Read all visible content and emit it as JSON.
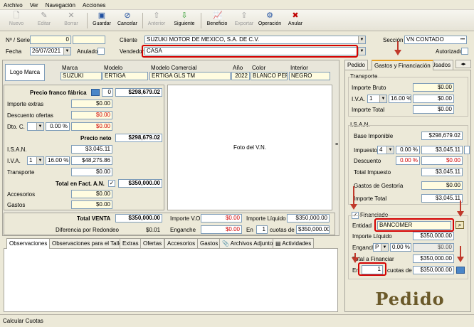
{
  "menu": [
    "Archivo",
    "Ver",
    "Navegación",
    "Acciones"
  ],
  "toolbar": {
    "nuevo": "Nuevo",
    "editar": "Editar",
    "borrar": "Borrar",
    "guardar": "Guardar",
    "cancelar": "Cancelar",
    "anterior": "Anterior",
    "siguiente": "Siguiente",
    "beneficio": "Beneficio",
    "exportar": "Exportar",
    "operacion": "Operación",
    "anular": "Anular"
  },
  "header": {
    "serie_label": "Nº / Serie",
    "serie_num": "0",
    "serie_val": "",
    "fecha_label": "Fecha",
    "fecha": "26/07/2021",
    "anulado_label": "Anulado",
    "cliente_label": "Cliente",
    "cliente": "SUZUKI MOTOR DE MEXICO, S.A. DE C.V.",
    "vendedor_label": "Vendedor",
    "vendedor": "CASA",
    "seccion_label": "Sección",
    "seccion": "VN CONTADO",
    "autorizado_label": "Autorizado"
  },
  "vehicle": {
    "logo": "Logo Marca",
    "marca_label": "Marca",
    "marca": "SUZUKI",
    "modelo_label": "Modelo",
    "modelo": "ERTIGA",
    "comercial_label": "Modelo Comercial",
    "comercial": "ERTIGA GLS TM",
    "anio_label": "Año",
    "anio": "2022",
    "color_label": "Color",
    "color": "BLANCO PERL",
    "interior_label": "Interior",
    "interior": "NEGRO"
  },
  "pricing": {
    "franco_label": "Precio franco fábrica",
    "franco_qty": "0",
    "franco": "$298,679.02",
    "extras_label": "Importe extras",
    "extras": "$0.00",
    "desc_label": "Descuento ofertas",
    "desc": "$0.00",
    "dto_label": "Dto. C.",
    "dto_pct": "0.00 %",
    "dto": "$0.00",
    "neto_label": "Precio neto",
    "neto": "$298,679.02",
    "isan_label": "I.S.A.N.",
    "isan": "$3,045.11",
    "iva_label": "I.V.A.",
    "iva_sel": "1",
    "iva_pct": "16.00 %",
    "iva": "$48,275.86",
    "transporte_label": "Transporte",
    "transporte": "$0.00",
    "total_label": "Total en Fact. A.N.",
    "total": "$350,000.00",
    "accesorios_label": "Accesorios",
    "accesorios": "$0.00",
    "gastos_label": "Gastos",
    "gastos": "$0.00"
  },
  "photo_label": "Foto del V.N.",
  "summary": {
    "venta_label": "Total VENTA",
    "venta": "$350,000.00",
    "redondeo_label": "Diferencia por Redondeo",
    "redondeo": "$0.01",
    "vo_label": "Importe V.O.",
    "vo": "$0.00",
    "enganche_label": "Enganche",
    "enganche": "$0.00",
    "liquido_label": "Importe Líquido",
    "liquido": "$350,000.00",
    "en_label": "En",
    "cuotas_n": "1",
    "cuotas_label": "cuotas de",
    "cuotas": "$350,000.00"
  },
  "bottom_tabs": [
    "Observaciones",
    "Observaciones para el Taller",
    "Extras",
    "Ofertas",
    "Accesorios",
    "Gastos",
    "Archivos Adjuntos",
    "Actividades"
  ],
  "right_tabs": [
    "Pedido",
    "Gastos y Financiación",
    "Usados"
  ],
  "transporte": {
    "group": "Transporte",
    "bruto_label": "Importe Bruto",
    "bruto": "$0.00",
    "iva_label": "I.V.A.",
    "iva_sel": "1",
    "iva_pct": "16.00 %",
    "iva": "$0.00",
    "total_label": "Importe Total",
    "total": "$0.00"
  },
  "isan": {
    "group": "I.S.A.N.",
    "base_label": "Base Imponible",
    "base": "$298,679.02",
    "imp_label": "Impuesto",
    "imp_sel": "4",
    "imp_pct": "0.00 %",
    "imp": "$3,045.11",
    "desc_label": "Descuento",
    "desc_pct": "0.00 %",
    "desc": "$0.00",
    "total_label": "Total Impuesto",
    "total": "$3,045.11",
    "gestoria_label": "Gastos de Gestoría",
    "gestoria": "$0.00",
    "importe_total_label": "Importe Total",
    "importe_total": "$3,045.11"
  },
  "financiado": {
    "label": "Financiado",
    "entidad_label": "Entidad",
    "entidad": "BANCOMER",
    "liquido_label": "Importe Líquido",
    "liquido": "$350,000.00",
    "enganche_label": "Enganche",
    "enganche_sel": "P",
    "enganche_pct": "0.00 %",
    "enganche": "$0.00",
    "total_label": "Total a Financiar",
    "total": "$350,000.00",
    "en_label": "En",
    "cuotas_n": "1",
    "cuotas_label": "cuotas de",
    "cuotas": "$350,000.00"
  },
  "watermark": "Pedido",
  "status": "Calcular Cuotas",
  "colors": {
    "highlight": "#d40000",
    "arrow": "#c0392b",
    "field_yellow": "#fffce0"
  }
}
